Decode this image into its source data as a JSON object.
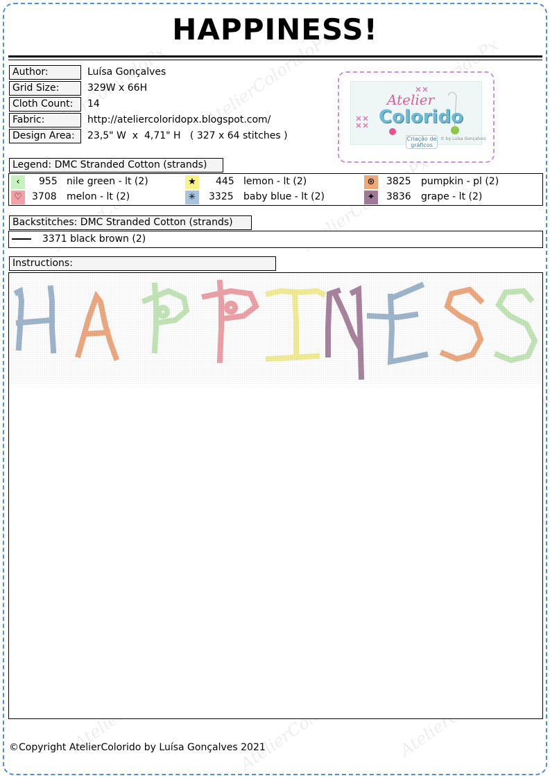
{
  "title": "HAPPINESS!",
  "info": {
    "author_label": "Author:",
    "author_value": "Luísa Gonçalves",
    "grid_label": "Grid Size:",
    "grid_value": "329W x 66H",
    "cloth_label": "Cloth Count:",
    "cloth_value": "14",
    "fabric_label": "Fabric:",
    "fabric_value": "http://ateliercoloridopx.blogspot.com/",
    "design_label": "Design Area:",
    "design_value": "23,5\" W  x  4,71\" H   ( 327 x 64 stitches )"
  },
  "logo": {
    "atelier": "Atelier",
    "colorido": "Colorido",
    "creation": "Criação de gráficos",
    "by": "© by Luísa Gonçalves"
  },
  "legend": {
    "header": "Legend: DMC Stranded Cotton (strands)",
    "items": [
      {
        "symbol": "‹",
        "bg": "#c8f0c0",
        "code": "955",
        "name": "nile green - lt (2)"
      },
      {
        "symbol": "★",
        "bg": "#f7f38a",
        "code": "445",
        "name": "lemon - lt (2)"
      },
      {
        "symbol": "⊛",
        "bg": "#f0a878",
        "code": "3825",
        "name": "pumpkin - pl (2)"
      },
      {
        "symbol": "♡",
        "bg": "#f4a0a8",
        "code": "3708",
        "name": "melon - lt (2)"
      },
      {
        "symbol": "✳",
        "bg": "#a8c4dc",
        "code": "3325",
        "name": "baby blue - lt (2)"
      },
      {
        "symbol": "✦",
        "bg": "#a07898",
        "code": "3836",
        "name": "grape - lt (2)"
      }
    ]
  },
  "backstitch": {
    "header": "Backstitches: DMC Stranded Cotton (strands)",
    "item": "3371  black brown (2)"
  },
  "instructions": {
    "header": "Instructions:"
  },
  "pattern": {
    "letters": [
      "H",
      "A",
      "P",
      "P",
      "I",
      "N",
      "E",
      "S",
      "S"
    ],
    "colors": {
      "baby_blue": "#9fb6cc",
      "pumpkin": "#eeaa80",
      "nile_green": "#c3e6b8",
      "melon": "#eda2a8",
      "lemon": "#f3ee96",
      "grape": "#a8849e"
    }
  },
  "watermark": "AtelierColoridoPx",
  "copyright": "©Copyright AtelierColorido by Luísa Gonçalves 2021"
}
